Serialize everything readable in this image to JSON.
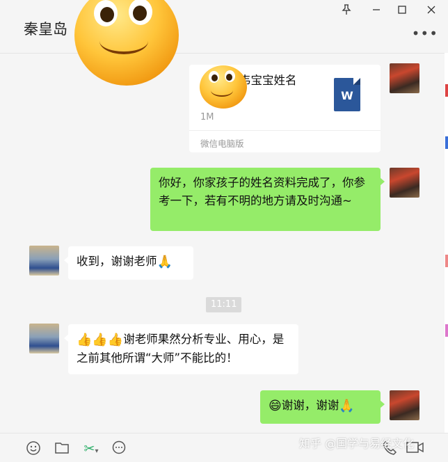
{
  "window": {
    "title": "秦皇岛",
    "pin_icon": "pin-icon",
    "minimize_icon": "minimize-icon",
    "maximize_icon": "maximize-icon",
    "close_icon": "close-icon",
    "more_icon": "more-icon"
  },
  "chat": {
    "file_message": {
      "file_name": "韦宝宝姓名",
      "file_name_line2": "",
      "file_size": "1M",
      "source": "微信电脑版",
      "file_type_letter": "W"
    },
    "messages": [
      {
        "side": "right",
        "text": "你好，你家孩子的姓名资料完成了，你参考一下，若有不明的地方请及时沟通~"
      },
      {
        "side": "left",
        "text": "收到，谢谢老师",
        "emoji": "🙏"
      },
      {
        "side": "left",
        "prefix_emoji": "👍👍👍",
        "text": "谢老师果然分析专业、用心，是之前其他所谓“大师”不能比的！"
      },
      {
        "side": "right",
        "prefix_emoji": "😄",
        "text": "谢谢，谢谢",
        "emoji": "🙏"
      }
    ],
    "timestamp": "11:11"
  },
  "toolbar": {
    "emoji_icon": "☺",
    "folder_icon": "folder-icon",
    "scissors_icon": "✂",
    "chat_icon": "chat-bubble-icon",
    "phone_icon": "phone-icon",
    "video_icon": "video-icon"
  },
  "watermark": "知乎 @国学与易经文化",
  "colors": {
    "sent_bubble": "#95ec69",
    "received_bubble": "#ffffff",
    "background": "#f5f5f5",
    "word_blue": "#2b579a"
  }
}
